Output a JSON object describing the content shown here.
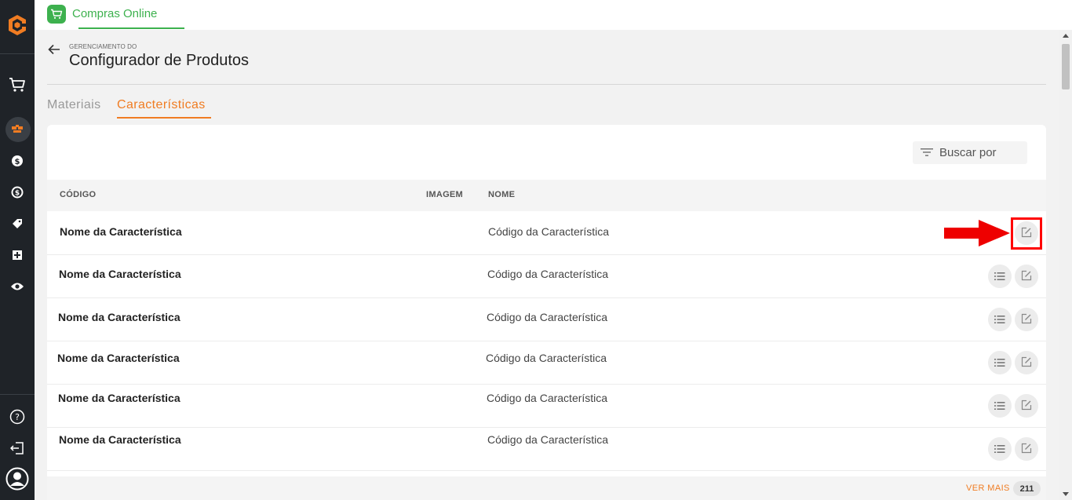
{
  "app": {
    "title": "Compras Online"
  },
  "header": {
    "kicker": "GERENCIAMENTO DO",
    "title": "Configurador de Produtos"
  },
  "tabs": [
    {
      "label": "Materiais",
      "active": false
    },
    {
      "label": "Características",
      "active": true
    }
  ],
  "search": {
    "placeholder": "Buscar por"
  },
  "table": {
    "columns": [
      "CÓDIGO",
      "IMAGEM",
      "NOME"
    ],
    "rows": [
      {
        "name": "Nome da Característica",
        "code": "Código da Característica"
      },
      {
        "name": "Nome da Característica",
        "code": "Código da Característica"
      },
      {
        "name": "Nome da Característica",
        "code": "Código da Característica"
      },
      {
        "name": "Nome da Característica",
        "code": "Código da Característica"
      },
      {
        "name": "Nome da Característica",
        "code": "Código da Característica"
      },
      {
        "name": "Nome da Característica",
        "code": "Código da Característica"
      }
    ]
  },
  "footer": {
    "see_more": "VER MAIS",
    "count": "211"
  },
  "sidebar": {
    "icons": [
      "logo-icon",
      "cart-icon",
      "configurator-icon",
      "money-icon",
      "exchange-icon",
      "tag-icon",
      "grid-icon",
      "eye-icon",
      "help-icon",
      "logout-icon",
      "user-avatar-icon"
    ]
  },
  "colors": {
    "accent": "#f07c22",
    "app_green": "#3db14e",
    "sidebar_bg": "#1f2328",
    "highlight": "#ff0000"
  }
}
